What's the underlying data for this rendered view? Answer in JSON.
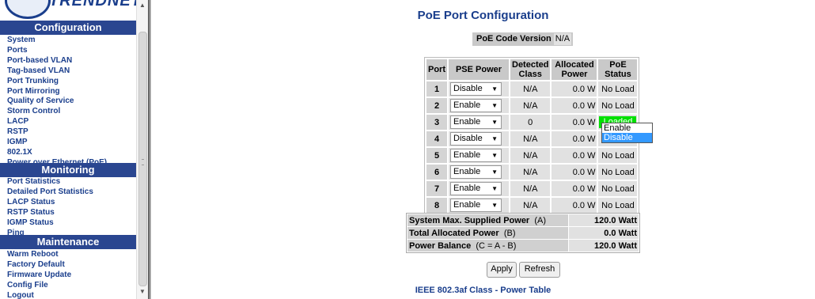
{
  "sidebar": {
    "logo_text": "TRENDNET",
    "configuration_heading": "Configuration",
    "configuration_items": [
      "System",
      "Ports",
      "Port-based VLAN",
      "Tag-based VLAN",
      "Port Trunking",
      "Port Mirroring",
      "Quality of Service",
      "Storm Control",
      "LACP",
      "RSTP",
      "IGMP",
      "802.1X",
      "Power over Ethernet (PoE)"
    ],
    "monitoring_heading": "Monitoring",
    "monitoring_items": [
      "Port Statistics",
      "Detailed Port Statistics",
      "LACP Status",
      "RSTP Status",
      "IGMP Status",
      "Ping"
    ],
    "maintenance_heading": "Maintenance",
    "maintenance_items": [
      "Warm Reboot",
      "Factory Default",
      "Firmware Update",
      "Config File",
      "Logout"
    ]
  },
  "main": {
    "title": "PoE Port Configuration",
    "code_version_label": "PoE Code Version",
    "code_version_value": "N/A",
    "table_headers": {
      "port": "Port",
      "pse_power": "PSE Power",
      "detected_class_1": "Detected",
      "detected_class_2": "Class",
      "allocated_power_1": "Allocated",
      "allocated_power_2": "Power",
      "poe_status_1": "PoE",
      "poe_status_2": "Status"
    },
    "ports": [
      {
        "port": "1",
        "pse": "Disable",
        "class": "N/A",
        "power": "0.0 W",
        "status": "No Load"
      },
      {
        "port": "2",
        "pse": "Enable",
        "class": "N/A",
        "power": "0.0 W",
        "status": "No Load"
      },
      {
        "port": "3",
        "pse": "Enable",
        "class": "0",
        "power": "0.0 W",
        "status": "Loaded"
      },
      {
        "port": "4",
        "pse": "Disable",
        "class": "N/A",
        "power": "0.0 W",
        "status": "No Load"
      },
      {
        "port": "5",
        "pse": "Enable",
        "class": "N/A",
        "power": "0.0 W",
        "status": "No Load"
      },
      {
        "port": "6",
        "pse": "Enable",
        "class": "N/A",
        "power": "0.0 W",
        "status": "No Load"
      },
      {
        "port": "7",
        "pse": "Enable",
        "class": "N/A",
        "power": "0.0 W",
        "status": "No Load"
      },
      {
        "port": "8",
        "pse": "Enable",
        "class": "N/A",
        "power": "0.0 W",
        "status": "No Load"
      }
    ],
    "dropdown_options": [
      "Enable",
      "Disable"
    ],
    "dropdown_highlighted": "Disable",
    "power_summary": [
      {
        "label": "System Max. Supplied Power",
        "suffix": "(A)",
        "value": "120.0 Watt"
      },
      {
        "label": "Total Allocated Power",
        "suffix": "(B)",
        "value": "0.0 Watt"
      },
      {
        "label": "Power Balance",
        "suffix": "(C = A - B)",
        "value": "120.0 Watt"
      }
    ],
    "apply_label": "Apply",
    "refresh_label": "Refresh",
    "footer_title": "IEEE 802.3af Class - Power Table"
  },
  "colors": {
    "accent": "#1a3e8c",
    "section_header": "#2a4690",
    "loaded_status": "#00e000",
    "header_cell": "#c9c9c9",
    "body_cell": "#e1e1e1"
  }
}
